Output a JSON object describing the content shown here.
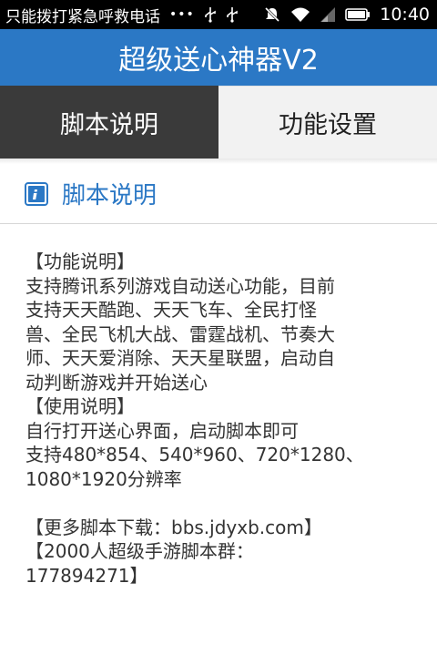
{
  "statusbar": {
    "carrier_text": "只能拨打紧急呼救电话",
    "dots": "•••",
    "time": "10:40",
    "icons": [
      "usb-icon",
      "usb-icon",
      "mute-icon",
      "wifi-icon",
      "signal-icon",
      "battery-icon"
    ]
  },
  "appbar": {
    "title": "超级送心神器V2"
  },
  "tabs": [
    {
      "label": "脚本说明",
      "active": true
    },
    {
      "label": "功能设置",
      "active": false
    }
  ],
  "section": {
    "title": "脚本说明",
    "icon": "info-icon"
  },
  "content": {
    "lines": [
      "【功能说明】",
      "支持腾讯系列游戏自动送心功能，目前",
      "支持天天酷跑、天天飞车、全民打怪",
      "兽、全民飞机大战、雷霆战机、节奏大",
      "师、天天爱消除、天天星联盟，启动自",
      "动判断游戏并开始送心",
      "【使用说明】",
      "自行打开送心界面，启动脚本即可",
      "支持480*854、540*960、720*1280、",
      "1080*1920分辨率",
      "",
      "【更多脚本下载：bbs.jdyxb.com】",
      "【2000人超级手游脚本群：",
      "177894271】"
    ]
  },
  "colors": {
    "accent": "#2b78c5",
    "active_tab": "#3a3a3a",
    "inactive_tab": "#f2f2f2"
  }
}
